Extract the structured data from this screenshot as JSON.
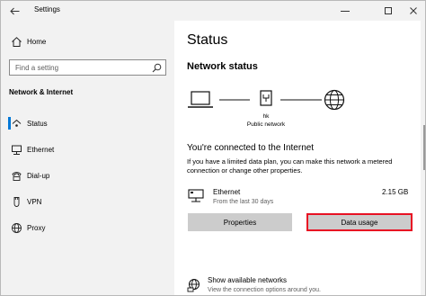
{
  "window": {
    "title": "Settings"
  },
  "sidebar": {
    "home_label": "Home",
    "search_placeholder": "Find a setting",
    "section_label": "Network & Internet",
    "items": [
      {
        "label": "Status",
        "icon": "status-icon",
        "active": true
      },
      {
        "label": "Ethernet",
        "icon": "ethernet-icon"
      },
      {
        "label": "Dial-up",
        "icon": "dialup-icon"
      },
      {
        "label": "VPN",
        "icon": "vpn-icon"
      },
      {
        "label": "Proxy",
        "icon": "globe-icon"
      }
    ]
  },
  "main": {
    "title": "Status",
    "network_status_heading": "Network status",
    "diagram": {
      "network_name": "hk",
      "network_type": "Public network"
    },
    "connected_heading": "You're connected to the Internet",
    "description": "If you have a limited data plan, you can make this network a metered connection or change other properties.",
    "connection": {
      "name": "Ethernet",
      "period": "From the last 30 days",
      "usage": "2.15 GB"
    },
    "buttons": {
      "properties": "Properties",
      "data_usage": "Data usage"
    },
    "show_networks": {
      "title": "Show available networks",
      "subtitle": "View the connection options around you."
    }
  },
  "colors": {
    "accent": "#0078d7",
    "highlight_border": "#e81123",
    "sidebar_bg": "#f2f2f2",
    "button_bg": "#cccccc"
  }
}
